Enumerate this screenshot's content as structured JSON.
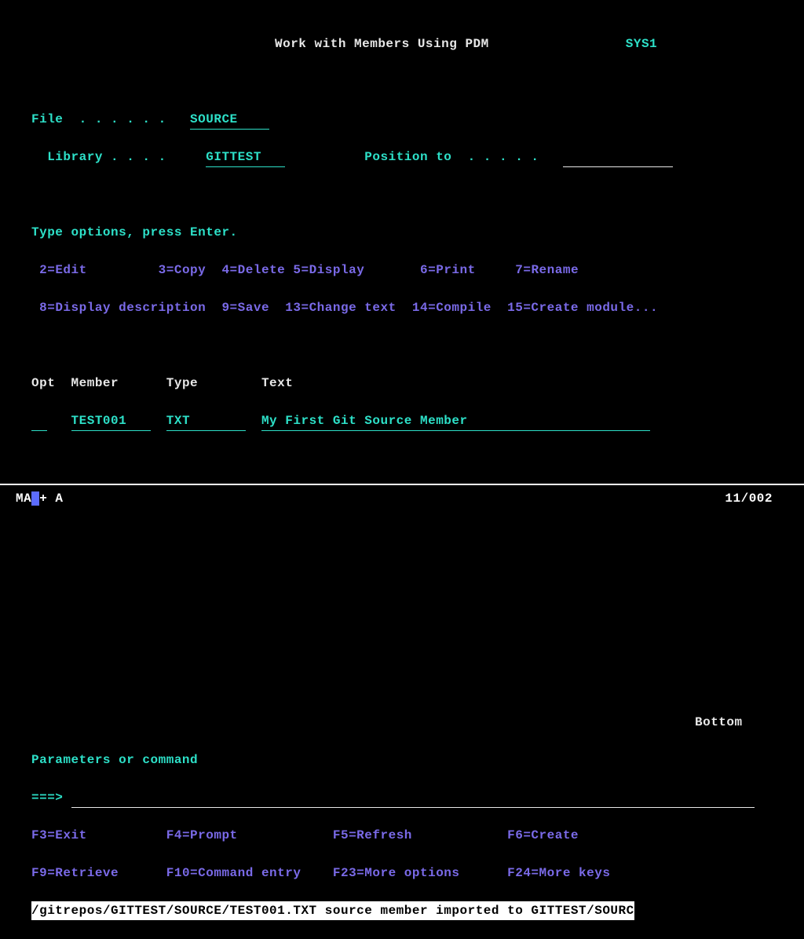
{
  "header": {
    "title": "Work with Members Using PDM",
    "system": "SYS1"
  },
  "file_row": {
    "label": "File  . . . . . .",
    "value": "SOURCE    "
  },
  "library_row": {
    "label": "  Library . . . .",
    "value": "GITTEST   ",
    "position_label": "Position to  . . . . ."
  },
  "instructions": "Type options, press Enter.",
  "options_line1": {
    "o2": "2=Edit",
    "o3": "3=Copy",
    "o4": "4=Delete",
    "o5": "5=Display",
    "o6": "6=Print",
    "o7": "7=Rename"
  },
  "options_line2": {
    "o8": "8=Display description",
    "o9": "9=Save",
    "o13": "13=Change text",
    "o14": "14=Compile",
    "o15": "15=Create module..."
  },
  "columns": {
    "opt": "Opt",
    "member": "Member",
    "type": "Type",
    "text": "Text"
  },
  "rows": [
    {
      "opt": "  ",
      "member": "TEST001   ",
      "type": "TXT       ",
      "text": "My First Git Source Member                       "
    }
  ],
  "bottom_marker": "Bottom",
  "cmd_label": "Parameters or command",
  "cmd_prompt": "===>",
  "fkeys_line1": {
    "f3": "F3=Exit",
    "f4": "F4=Prompt",
    "f5": "F5=Refresh",
    "f6": "F6=Create"
  },
  "fkeys_line2": {
    "f9": "F9=Retrieve",
    "f10": "F10=Command entry",
    "f23": "F23=More options",
    "f24": "F24=More keys"
  },
  "message": "/gitrepos/GITTEST/SOURCE/TEST001.TXT source member imported to GITTEST/SOURC",
  "status": {
    "left_prefix": "MA",
    "left_suffix": "+  A",
    "position": "11/002"
  }
}
